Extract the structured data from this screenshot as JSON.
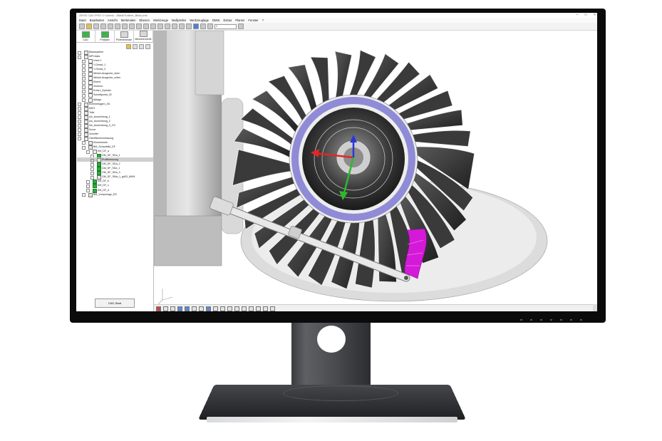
{
  "window": {
    "title": "ZEISS CALYPSO  C:\\Users\\...\\Blisk\\Turbine_Blisk.pms",
    "controls": "– □ ×"
  },
  "menu": [
    "Datei",
    "Bearbeiten",
    "Ansicht",
    "Merkmalen",
    "Ebenen",
    "Werkzeuge",
    "Maßprüfen",
    "Werkzeuglage",
    "DMIS",
    "Extras",
    "Planen",
    "Fenster",
    "?"
  ],
  "toolbar": {
    "input_value": "1"
  },
  "tabs": [
    {
      "label": "CAD",
      "icon": "cad-icon"
    },
    {
      "label": "Prüfplan",
      "icon": "plan-icon"
    },
    {
      "label": "Prüfmerkmale",
      "icon": "feature-icon"
    },
    {
      "label": "Messelemente",
      "icon": "element-icon"
    }
  ],
  "tree": [
    {
      "label": "Basissystem",
      "indent": 0,
      "icon": "doc"
    },
    {
      "label": "MPCdata",
      "indent": 0,
      "icon": "doc"
    },
    {
      "label": "Ursel 1",
      "indent": 1,
      "icon": "box"
    },
    {
      "label": "Y-Gerad_1",
      "indent": 1,
      "icon": "box"
    },
    {
      "label": "Y-Gerad_2",
      "indent": 1,
      "icon": "box"
    },
    {
      "label": "Winkel-Ausgrube_oben",
      "indent": 1,
      "icon": "box"
    },
    {
      "label": "Winkel-Ausgrube_unten",
      "indent": 1,
      "icon": "box"
    },
    {
      "label": "Ebene",
      "indent": 1,
      "icon": "box"
    },
    {
      "label": "Zentrum",
      "indent": 1,
      "icon": "box"
    },
    {
      "label": "Kreis1_Zylinder",
      "indent": 1,
      "icon": "box"
    },
    {
      "label": "Schnittpunkt_02",
      "indent": 1,
      "icon": "box"
    },
    {
      "label": "Ablage",
      "indent": 1,
      "icon": "box"
    },
    {
      "label": "Elementlager1_06",
      "indent": 0,
      "icon": "doc"
    },
    {
      "label": "MKO",
      "indent": 0,
      "icon": "doc"
    },
    {
      "label": "Teile",
      "indent": 0,
      "icon": "doc"
    },
    {
      "label": "AA_Ausrichtung_1",
      "indent": 0,
      "icon": "doc"
    },
    {
      "label": "AA_Ausrichtung_2",
      "indent": 0,
      "icon": "doc"
    },
    {
      "label": "AA_Ausrichtung_3_CS",
      "indent": 0,
      "icon": "doc"
    },
    {
      "label": "Kurve",
      "indent": 0,
      "icon": "doc"
    },
    {
      "label": "Schnitte",
      "indent": 0,
      "icon": "doc"
    },
    {
      "label": "Oberflächenmessung",
      "indent": 0,
      "icon": "doc"
    },
    {
      "label": "Elementsets",
      "indent": 1,
      "icon": "doc"
    },
    {
      "label": "BM_Schaufelbl_DF",
      "indent": 1,
      "icon": "doc"
    },
    {
      "label": "KM_DF_a",
      "indent": 2,
      "icon": "doc"
    },
    {
      "label": "GM_DF_SDa_1",
      "indent": 3,
      "icon": "green"
    },
    {
      "label": "Profilmessung",
      "indent": 3,
      "icon": "doc",
      "selected": true
    },
    {
      "label": "GM_DF_SDa_2",
      "indent": 3,
      "icon": "green"
    },
    {
      "label": "Dat_DF_SDa_1",
      "indent": 3,
      "icon": "green"
    },
    {
      "label": "GM_DF_SDa_3",
      "indent": 3,
      "icon": "green"
    },
    {
      "label": "GM_DF_SMa_1_gd03_MKM",
      "indent": 3,
      "icon": "doc"
    },
    {
      "label": "KM_DF_b",
      "indent": 2,
      "icon": "green"
    },
    {
      "label": "KM_DF_c",
      "indent": 2,
      "icon": "green"
    },
    {
      "label": "KM_DF_d",
      "indent": 2,
      "icon": "green"
    },
    {
      "label": "BM_Vorsprünge_DS",
      "indent": 1,
      "icon": "doc"
    }
  ],
  "cnc_button": "CNC-Start",
  "colors": {
    "axis_x": "#e32626",
    "axis_y": "#2db82d",
    "axis_z": "#2a37d6",
    "highlight": "#d41ad8",
    "ring": "#8f8bd6"
  }
}
